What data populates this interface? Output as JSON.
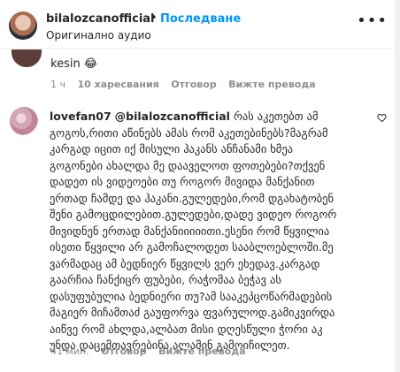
{
  "header": {
    "username": "bilalozcanofficial",
    "separator": "•",
    "follow_label": "Последване",
    "subtitle": "Оригинално аудио"
  },
  "previous_comment": {
    "text": "kesin 😂",
    "meta": {
      "time": "1 ч",
      "likes": "10 харесвания",
      "reply": "Отговор",
      "view_translation": "Вижте превода"
    }
  },
  "comment": {
    "username": "lovefan07",
    "mention": "@bilalozcanofficial",
    "text": "რას აკეთებთ ამ გოგოს,რითი აწინებს ამას რომ აკეთებინებს?მაგრამ კარგად იცით იქ მისული ჰაკანს ანჩანამი ხმეა გოგონები ახალდა მე დააველოთ ფოთებები?თქვენ დადეთ ის ვიდეოები თუ როგორ მივიდა მანქანით ერთად ჩამდე და ჰაკანი.გულედები,რომ დგახატობენ შენი გამოცდილებით.გულედები,დადე ვიდეო როგორ მივიდნენ ერთად მანქანიიიიითი.ესენი რომ წყვილია ისეთი წყვილი არ გამოჩალოდეთ სააბლოებლოში.მე ვარმადაც ამ ბედნიერ წყვილს ვერ ეხედავ.კარგად გაარჩია ჩანქიცრ ფუბები, რაჭომაა ბეჭავ ას დასუფუბულია ბედნიერი თუ?ამ სააკეპცოწარმადების მაგიერ მიჩამთაძ გაუფორვა ფვარულოდ.გამიკვირდა აიწვე რომ ახლდა,ალბათ მისი დღესწული ჭორი აკ უნდა დაცემთავრებინა.ალამინ გამოიჩილეთ.",
    "meta": {
      "time": "41 мин.",
      "reply": "Отговор",
      "view_translation": "Вижте превода"
    }
  },
  "icons": {
    "more": "more-options-icon",
    "heart": "heart-icon",
    "avatar": "user-avatar"
  }
}
